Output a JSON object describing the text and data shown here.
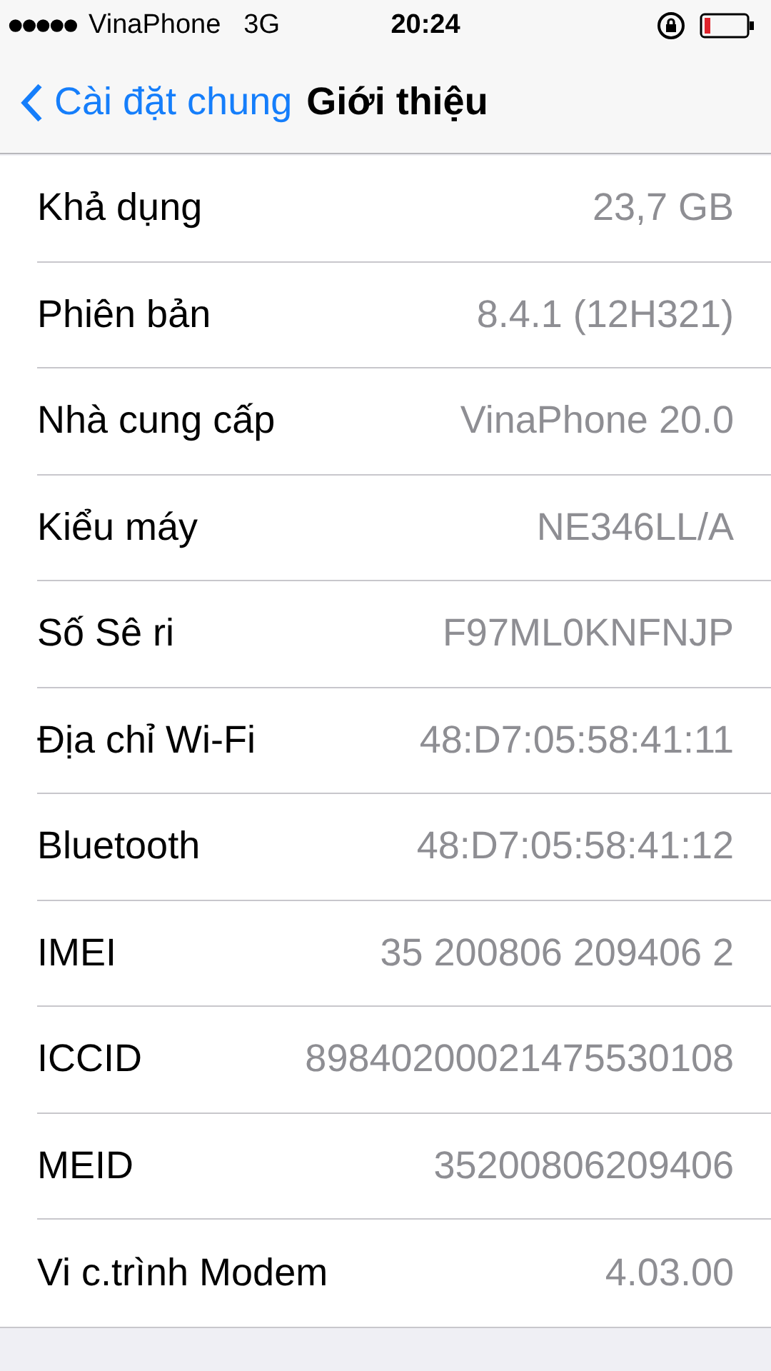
{
  "status_bar": {
    "carrier": "VinaPhone",
    "network": "3G",
    "time": "20:24"
  },
  "nav": {
    "back": "Cài đặt chung",
    "title": "Giới thiệu"
  },
  "rows": [
    {
      "label": "Khả dụng",
      "value": "23,7 GB"
    },
    {
      "label": "Phiên bản",
      "value": "8.4.1 (12H321)"
    },
    {
      "label": "Nhà cung cấp",
      "value": "VinaPhone 20.0"
    },
    {
      "label": "Kiểu máy",
      "value": "NE346LL/A"
    },
    {
      "label": "Số Sê ri",
      "value": "F97ML0KNFNJP"
    },
    {
      "label": "Địa chỉ Wi-Fi",
      "value": "48:D7:05:58:41:11"
    },
    {
      "label": "Bluetooth",
      "value": "48:D7:05:58:41:12"
    },
    {
      "label": "IMEI",
      "value": "35 200806 209406 2"
    },
    {
      "label": "ICCID",
      "value": "89840200021475530108"
    },
    {
      "label": "MEID",
      "value": "35200806209406"
    },
    {
      "label": "Vi c.trình Modem",
      "value": "4.03.00"
    }
  ]
}
